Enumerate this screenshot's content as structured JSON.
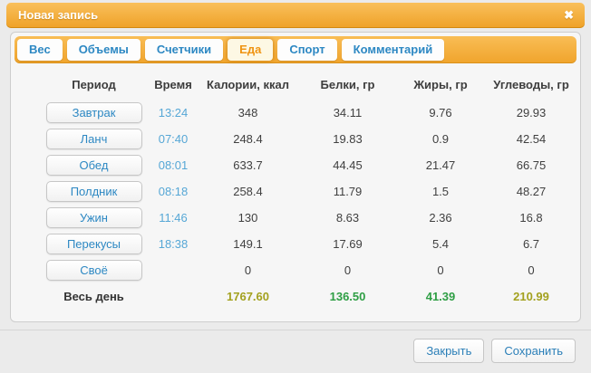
{
  "dialog": {
    "title": "Новая запись",
    "close_icon": "✖"
  },
  "tabs": [
    {
      "label": "Вес",
      "active": false
    },
    {
      "label": "Объемы",
      "active": false
    },
    {
      "label": "Счетчики",
      "active": false
    },
    {
      "label": "Еда",
      "active": true
    },
    {
      "label": "Спорт",
      "active": false
    },
    {
      "label": "Комментарий",
      "active": false
    }
  ],
  "table": {
    "headers": [
      "Период",
      "Время",
      "Калории, ккал",
      "Белки, гр",
      "Жиры, гр",
      "Углеводы, гр"
    ],
    "rows": [
      {
        "period": "Завтрак",
        "time": "13:24",
        "calories": "348",
        "proteins": "34.11",
        "fats": "9.76",
        "carbs": "29.93"
      },
      {
        "period": "Ланч",
        "time": "07:40",
        "calories": "248.4",
        "proteins": "19.83",
        "fats": "0.9",
        "carbs": "42.54"
      },
      {
        "period": "Обед",
        "time": "08:01",
        "calories": "633.7",
        "proteins": "44.45",
        "fats": "21.47",
        "carbs": "66.75"
      },
      {
        "period": "Полдник",
        "time": "08:18",
        "calories": "258.4",
        "proteins": "11.79",
        "fats": "1.5",
        "carbs": "48.27"
      },
      {
        "period": "Ужин",
        "time": "11:46",
        "calories": "130",
        "proteins": "8.63",
        "fats": "2.36",
        "carbs": "16.8"
      },
      {
        "period": "Перекусы",
        "time": "18:38",
        "calories": "149.1",
        "proteins": "17.69",
        "fats": "5.4",
        "carbs": "6.7"
      },
      {
        "period": "Своё",
        "time": "",
        "calories": "0",
        "proteins": "0",
        "fats": "0",
        "carbs": "0"
      }
    ],
    "totals": {
      "label": "Весь день",
      "calories": "1767.60",
      "proteins": "136.50",
      "fats": "41.39",
      "carbs": "210.99"
    }
  },
  "footer": {
    "close_label": "Закрыть",
    "save_label": "Сохранить"
  },
  "colors": {
    "accent_orange": "#f0a42c",
    "link_blue": "#2d88c3",
    "time_blue": "#56a7d6",
    "total_olive": "#a3a11f",
    "total_green": "#2e9e44"
  }
}
